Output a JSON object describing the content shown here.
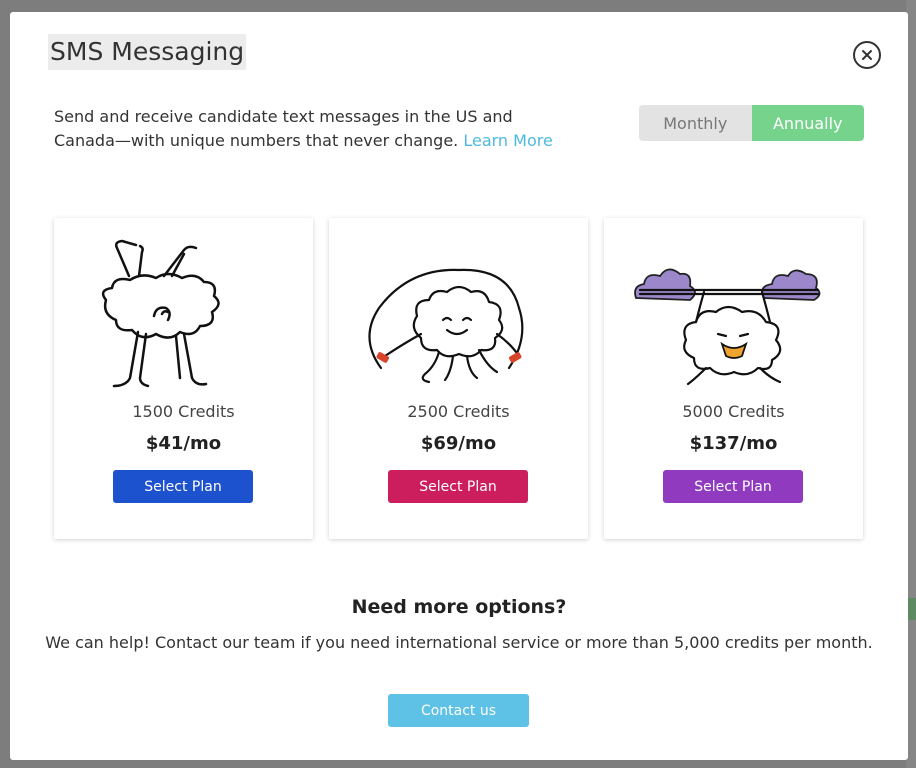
{
  "modal": {
    "title": "SMS Messaging",
    "description": "Send and receive candidate text messages in the US and Canada—with unique numbers that never change.",
    "learn_more": "Learn More"
  },
  "billing_toggle": {
    "options": [
      "Monthly",
      "Annually"
    ],
    "selected": "Annually"
  },
  "plans": [
    {
      "credits": "1500 Credits",
      "price": "$41/mo",
      "button": "Select Plan",
      "color": "#1d52cf",
      "illustration": "handstand-cloud-icon"
    },
    {
      "credits": "2500 Credits",
      "price": "$69/mo",
      "button": "Select Plan",
      "color": "#cc1d5d",
      "illustration": "jump-rope-cloud-icon"
    },
    {
      "credits": "5000 Credits",
      "price": "$137/mo",
      "button": "Select Plan",
      "color": "#8f3abf",
      "illustration": "weightlifting-cloud-icon"
    }
  ],
  "more_options": {
    "title": "Need more options?",
    "text": "We can help! Contact our team if you need international service or more than 5,000 credits per month.",
    "button": "Contact us"
  },
  "colors": {
    "toggle_active": "#76d38c",
    "toggle_inactive": "#e3e3e3",
    "link": "#4fb8e0",
    "contact_button": "#5ec1e6"
  }
}
